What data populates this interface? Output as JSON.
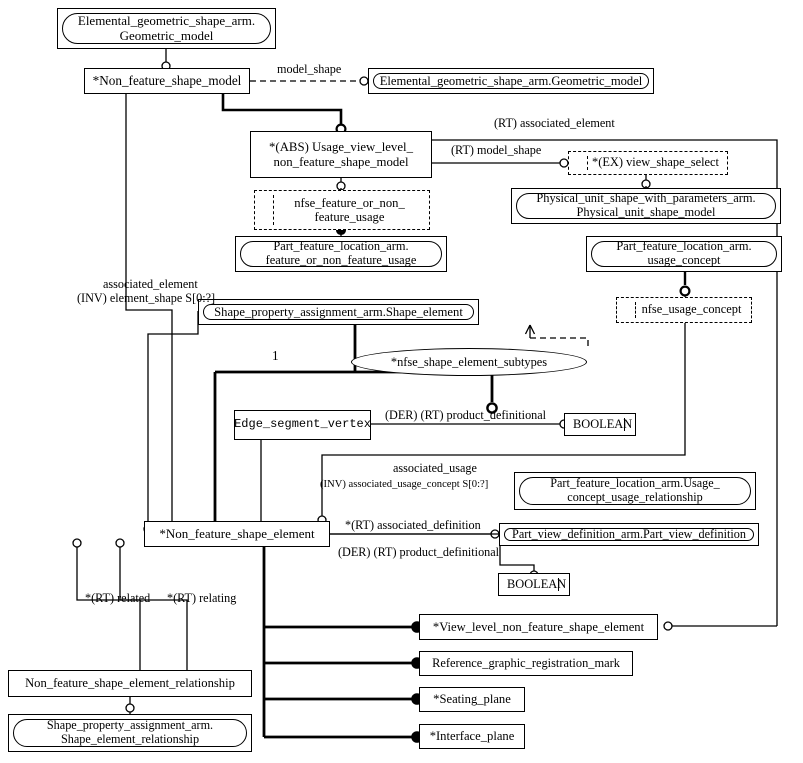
{
  "diagram": {
    "title": "EXPRESS-G entity level diagram for non_feature_shape_element_arm",
    "nodes": {
      "geometric_model_top": "Elemental_geometric_shape_arm.\nGeometric_model",
      "non_feature_shape_model": "*Non_feature_shape_model",
      "geometric_model_ref": "Elemental_geometric_shape_arm.Geometric_model",
      "usage_view_level": "*(ABS) Usage_view_level_\nnon_feature_shape_model",
      "view_shape_select": "*(EX) view_shape_select",
      "physical_unit_shape_model": "Physical_unit_shape_with_parameters_arm.\nPhysical_unit_shape_model",
      "nfse_feature_or_non_feature_usage": "nfse_feature_or_non_\nfeature_usage",
      "feature_or_non_feature_usage": "Part_feature_location_arm.\nfeature_or_non_feature_usage",
      "usage_concept": "Part_feature_location_arm.\nusage_concept",
      "nfse_usage_concept": "nfse_usage_concept",
      "shape_element": "Shape_property_assignment_arm.Shape_element",
      "nfse_shape_element_subtypes": "*nfse_shape_element_subtypes",
      "edge_segment_vertex": "Edge_segment_vertex",
      "boolean_upper": "BOOLEAN",
      "boolean_lower": "BOOLEAN",
      "usage_concept_usage_relationship": "Part_feature_location_arm.Usage_\nconcept_usage_relationship",
      "part_view_definition": "Part_view_definition_arm.Part_view_definition",
      "non_feature_shape_element": "*Non_feature_shape_element",
      "non_feature_shape_element_relationship": "Non_feature_shape_element_relationship",
      "shape_element_relationship": "Shape_property_assignment_arm.\nShape_element_relationship",
      "view_level_non_feature_shape_element": "*View_level_non_feature_shape_element",
      "reference_graphic_registration_mark": "Reference_graphic_registration_mark",
      "seating_plane": "*Seating_plane",
      "interface_plane": "*Interface_plane"
    },
    "edge_labels": {
      "model_shape": "model_shape",
      "rt_associated_element": "(RT) associated_element",
      "rt_model_shape": "(RT) model_shape",
      "associated_element": "associated_element",
      "inv_element_shape": "(INV) element_shape S[0:?]",
      "cardinality_one": "1",
      "der_rt_product_definitional_upper": "(DER) (RT) product_definitional",
      "associated_usage": "associated_usage",
      "inv_associated_usage_concept": "(INV) associated_usage_concept S[0:?]",
      "rt_associated_definition": "*(RT) associated_definition",
      "der_rt_product_definitional_lower": "(DER) (RT) product_definitional",
      "rt_related": "*(RT) related",
      "rt_relating": "*(RT) relating"
    },
    "colors": {
      "line": "#000000",
      "background": "#ffffff",
      "text": "#000000"
    }
  }
}
